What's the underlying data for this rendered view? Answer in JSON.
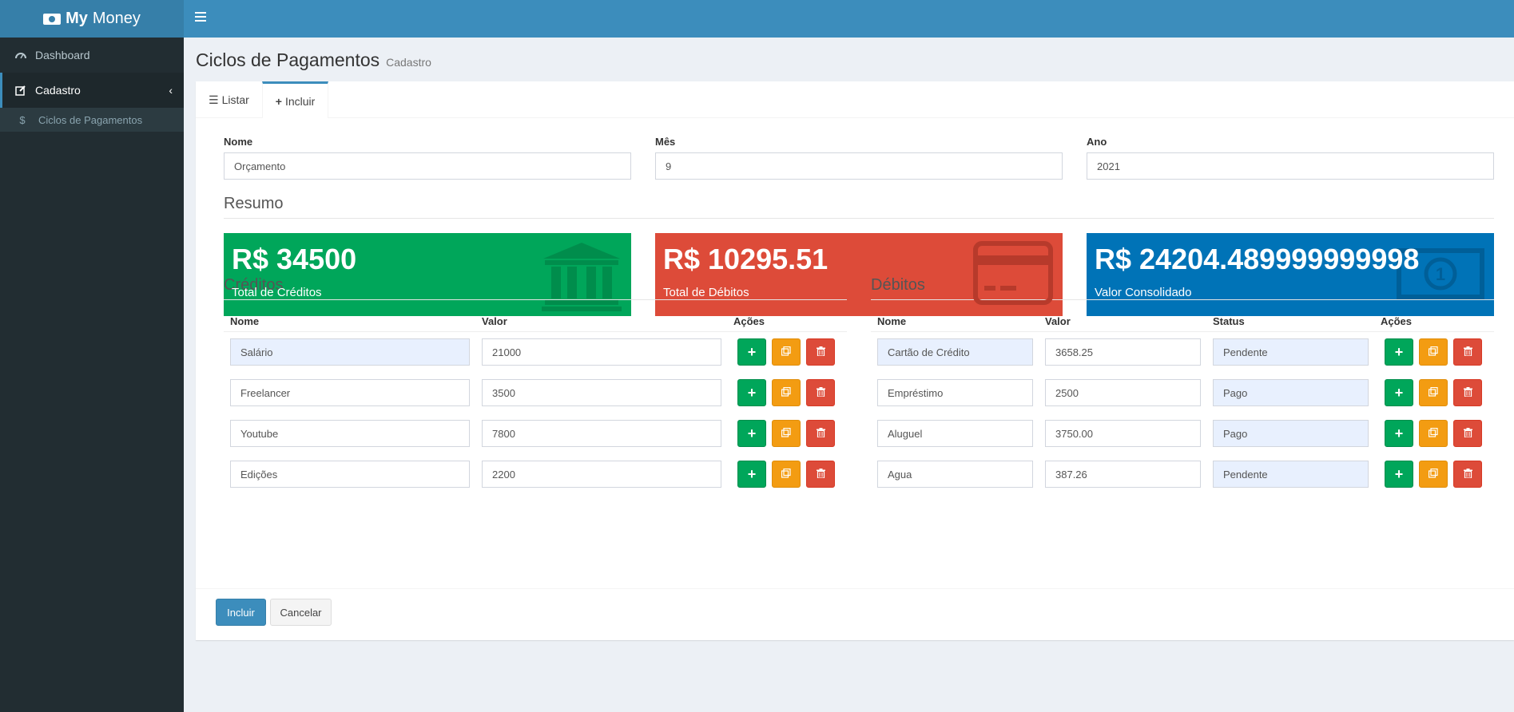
{
  "app": {
    "logo_bold": "My",
    "logo_rest": "Money"
  },
  "sidebar": {
    "items": [
      {
        "label": "Dashboard",
        "icon": "dashboard-icon"
      },
      {
        "label": "Cadastro",
        "icon": "edit-icon"
      }
    ],
    "subitems": [
      {
        "label": "Ciclos de Pagamentos",
        "icon": "dollar-icon"
      }
    ]
  },
  "page": {
    "title": "Ciclos de Pagamentos",
    "subtitle": "Cadastro"
  },
  "tabs": [
    {
      "label": "Listar",
      "icon": "list-icon"
    },
    {
      "label": "Incluir",
      "icon": "plus-icon"
    }
  ],
  "form": {
    "nome_label": "Nome",
    "nome_value": "Orçamento",
    "mes_label": "Mês",
    "mes_value": "9",
    "ano_label": "Ano",
    "ano_value": "2021"
  },
  "resumo": {
    "title": "Resumo",
    "credits": {
      "value": "R$ 34500",
      "label": "Total de Créditos",
      "color": "#00a65a"
    },
    "debits": {
      "value": "R$ 10295.51",
      "label": "Total de Débitos",
      "color": "#dd4b39"
    },
    "consolidated": {
      "value": "R$ 24204.489999999998",
      "label": "Valor Consolidado",
      "color": "#0073b7"
    }
  },
  "creditos": {
    "title": "Créditos",
    "headers": [
      "Nome",
      "Valor",
      "Ações"
    ],
    "rows": [
      {
        "nome": "Salário",
        "valor": "21000"
      },
      {
        "nome": "Freelancer",
        "valor": "3500"
      },
      {
        "nome": "Youtube",
        "valor": "7800"
      },
      {
        "nome": "Edições",
        "valor": "2200"
      }
    ]
  },
  "debitos": {
    "title": "Débitos",
    "headers": [
      "Nome",
      "Valor",
      "Status",
      "Ações"
    ],
    "rows": [
      {
        "nome": "Cartão de Crédito",
        "valor": "3658.25",
        "status": "Pendente"
      },
      {
        "nome": "Empréstimo",
        "valor": "2500",
        "status": "Pago"
      },
      {
        "nome": "Aluguel",
        "valor": "3750.00",
        "status": "Pago"
      },
      {
        "nome": "Agua",
        "valor": "387.26",
        "status": "Pendente"
      }
    ]
  },
  "actions": {
    "submit_label": "Incluir",
    "cancel_label": "Cancelar"
  }
}
